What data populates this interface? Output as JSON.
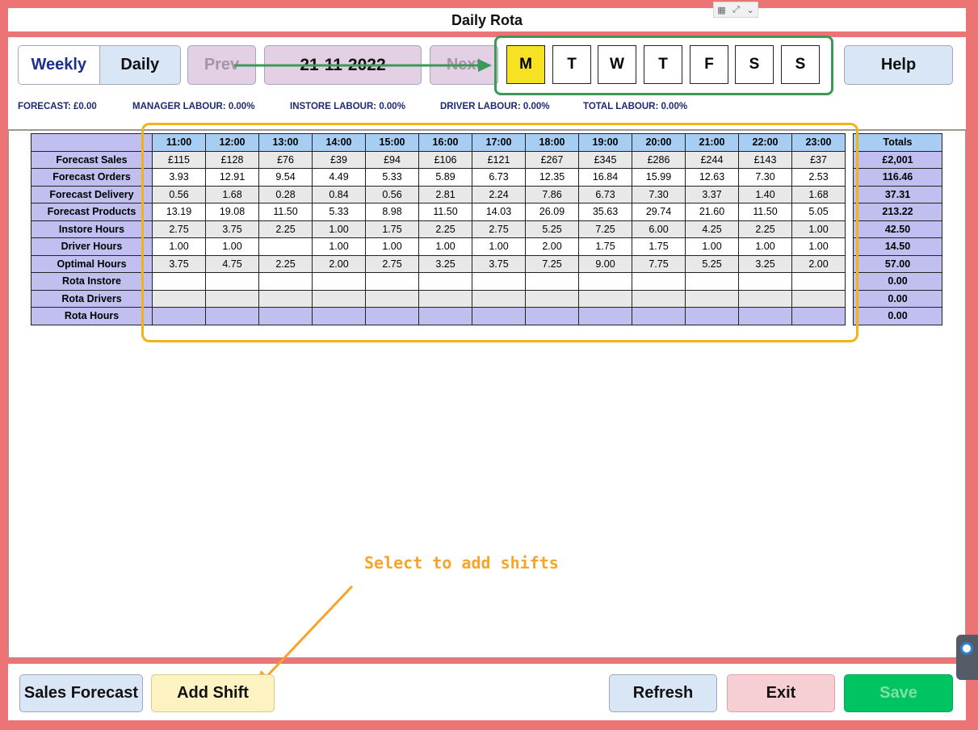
{
  "title": "Daily Rota",
  "view_toggle": {
    "weekly": "Weekly",
    "daily": "Daily",
    "selected": "Daily"
  },
  "nav": {
    "prev": "Prev",
    "date": "21-11-2022",
    "next": "Next"
  },
  "days": [
    "M",
    "T",
    "W",
    "T",
    "F",
    "S",
    "S"
  ],
  "selected_day_index": 0,
  "help_label": "Help",
  "summary": {
    "forecast": "FORECAST: £0.00",
    "manager_labour": "MANAGER LABOUR: 0.00%",
    "instore_labour": "INSTORE LABOUR: 0.00%",
    "driver_labour": "DRIVER LABOUR: 0.00%",
    "total_labour": "TOTAL LABOUR: 0.00%"
  },
  "table": {
    "hours": [
      "11:00",
      "12:00",
      "13:00",
      "14:00",
      "15:00",
      "16:00",
      "17:00",
      "18:00",
      "19:00",
      "20:00",
      "21:00",
      "22:00",
      "23:00"
    ],
    "totals_header": "Totals",
    "rows": [
      {
        "label": "Forecast Sales",
        "style": "grey",
        "values": [
          "£115",
          "£128",
          "£76",
          "£39",
          "£94",
          "£106",
          "£121",
          "£267",
          "£345",
          "£286",
          "£244",
          "£143",
          "£37"
        ],
        "total": "£2,001"
      },
      {
        "label": "Forecast Orders",
        "style": "light",
        "values": [
          "3.93",
          "12.91",
          "9.54",
          "4.49",
          "5.33",
          "5.89",
          "6.73",
          "12.35",
          "16.84",
          "15.99",
          "12.63",
          "7.30",
          "2.53"
        ],
        "total": "116.46"
      },
      {
        "label": "Forecast Delivery",
        "style": "grey",
        "values": [
          "0.56",
          "1.68",
          "0.28",
          "0.84",
          "0.56",
          "2.81",
          "2.24",
          "7.86",
          "6.73",
          "7.30",
          "3.37",
          "1.40",
          "1.68"
        ],
        "total": "37.31"
      },
      {
        "label": "Forecast Products",
        "style": "light",
        "values": [
          "13.19",
          "19.08",
          "11.50",
          "5.33",
          "8.98",
          "11.50",
          "14.03",
          "26.09",
          "35.63",
          "29.74",
          "21.60",
          "11.50",
          "5.05"
        ],
        "total": "213.22"
      },
      {
        "label": "Instore Hours",
        "style": "grey",
        "values": [
          "2.75",
          "3.75",
          "2.25",
          "1.00",
          "1.75",
          "2.25",
          "2.75",
          "5.25",
          "7.25",
          "6.00",
          "4.25",
          "2.25",
          "1.00"
        ],
        "total": "42.50"
      },
      {
        "label": "Driver Hours",
        "style": "light",
        "values": [
          "1.00",
          "1.00",
          "",
          "1.00",
          "1.00",
          "1.00",
          "1.00",
          "2.00",
          "1.75",
          "1.75",
          "1.00",
          "1.00",
          "1.00"
        ],
        "total": "14.50"
      },
      {
        "label": "Optimal Hours",
        "style": "grey",
        "values": [
          "3.75",
          "4.75",
          "2.25",
          "2.00",
          "2.75",
          "3.25",
          "3.75",
          "7.25",
          "9.00",
          "7.75",
          "5.25",
          "3.25",
          "2.00"
        ],
        "total": "57.00"
      },
      {
        "label": "Rota Instore",
        "style": "light",
        "values": [
          "",
          "",
          "",
          "",
          "",
          "",
          "",
          "",
          "",
          "",
          "",
          "",
          ""
        ],
        "total": "0.00"
      },
      {
        "label": "Rota Drivers",
        "style": "grey",
        "values": [
          "",
          "",
          "",
          "",
          "",
          "",
          "",
          "",
          "",
          "",
          "",
          "",
          ""
        ],
        "total": "0.00"
      },
      {
        "label": "Rota Hours",
        "style": "purple",
        "values": [
          "",
          "",
          "",
          "",
          "",
          "",
          "",
          "",
          "",
          "",
          "",
          "",
          ""
        ],
        "total": "0.00"
      }
    ]
  },
  "annotation": "Select to add shifts",
  "bottom": {
    "sales_forecast": "Sales Forecast",
    "add_shift": "Add Shift",
    "refresh": "Refresh",
    "exit": "Exit",
    "save": "Save"
  },
  "colors": {
    "frame": "#ec7474",
    "highlight_green": "#3b9a57",
    "highlight_yellow": "#f0b31a",
    "annotation": "#f7a428",
    "selected_day": "#f6e222",
    "save_green": "#00c462"
  }
}
